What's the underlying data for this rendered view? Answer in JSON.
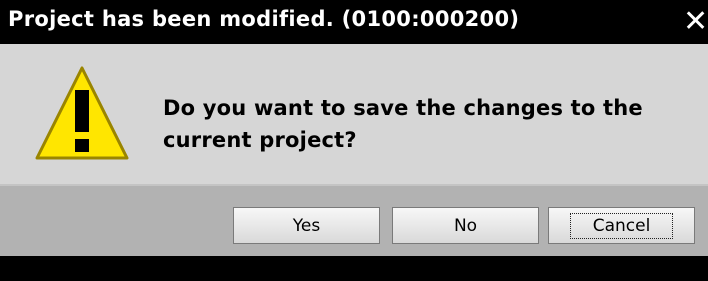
{
  "window": {
    "title": "Project has been modified. (0100:000200)",
    "close_symbol": "✕"
  },
  "icon": {
    "name": "warning-icon",
    "glyph": "!",
    "fill_color": "#ffe600",
    "stroke_color": "#9a8500"
  },
  "message": {
    "line1": "Do you want to save the changes to the",
    "line2": "current project?"
  },
  "buttons": {
    "yes_label": "Yes",
    "no_label": "No",
    "cancel_label": "Cancel"
  },
  "colors": {
    "titlebar": "#000000",
    "body": "#d6d6d6",
    "button_area": "#b2b2b2"
  }
}
